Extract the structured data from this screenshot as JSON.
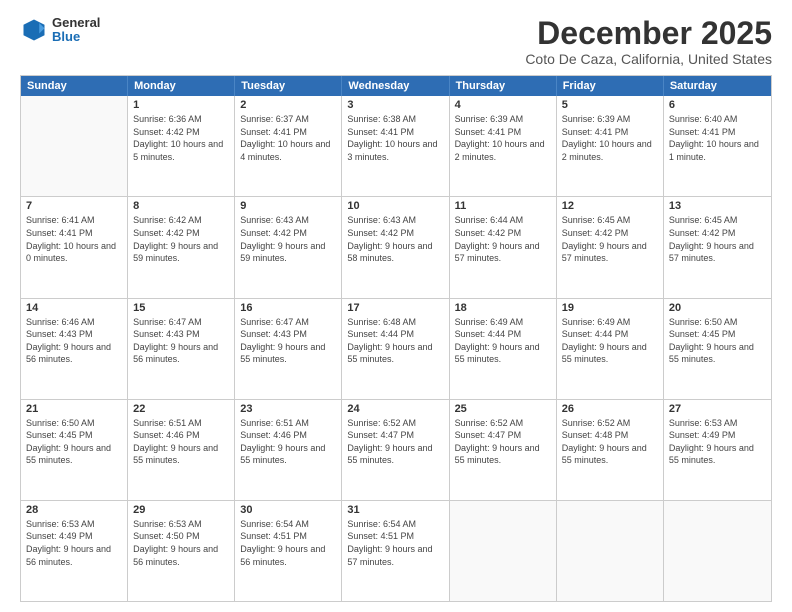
{
  "header": {
    "logo_general": "General",
    "logo_blue": "Blue",
    "main_title": "December 2025",
    "subtitle": "Coto De Caza, California, United States"
  },
  "days_of_week": [
    "Sunday",
    "Monday",
    "Tuesday",
    "Wednesday",
    "Thursday",
    "Friday",
    "Saturday"
  ],
  "weeks": [
    [
      {
        "day": "",
        "sunrise": "",
        "sunset": "",
        "daylight": "",
        "empty": true
      },
      {
        "day": "1",
        "sunrise": "Sunrise: 6:36 AM",
        "sunset": "Sunset: 4:42 PM",
        "daylight": "Daylight: 10 hours and 5 minutes."
      },
      {
        "day": "2",
        "sunrise": "Sunrise: 6:37 AM",
        "sunset": "Sunset: 4:41 PM",
        "daylight": "Daylight: 10 hours and 4 minutes."
      },
      {
        "day": "3",
        "sunrise": "Sunrise: 6:38 AM",
        "sunset": "Sunset: 4:41 PM",
        "daylight": "Daylight: 10 hours and 3 minutes."
      },
      {
        "day": "4",
        "sunrise": "Sunrise: 6:39 AM",
        "sunset": "Sunset: 4:41 PM",
        "daylight": "Daylight: 10 hours and 2 minutes."
      },
      {
        "day": "5",
        "sunrise": "Sunrise: 6:39 AM",
        "sunset": "Sunset: 4:41 PM",
        "daylight": "Daylight: 10 hours and 2 minutes."
      },
      {
        "day": "6",
        "sunrise": "Sunrise: 6:40 AM",
        "sunset": "Sunset: 4:41 PM",
        "daylight": "Daylight: 10 hours and 1 minute."
      }
    ],
    [
      {
        "day": "7",
        "sunrise": "Sunrise: 6:41 AM",
        "sunset": "Sunset: 4:41 PM",
        "daylight": "Daylight: 10 hours and 0 minutes."
      },
      {
        "day": "8",
        "sunrise": "Sunrise: 6:42 AM",
        "sunset": "Sunset: 4:42 PM",
        "daylight": "Daylight: 9 hours and 59 minutes."
      },
      {
        "day": "9",
        "sunrise": "Sunrise: 6:43 AM",
        "sunset": "Sunset: 4:42 PM",
        "daylight": "Daylight: 9 hours and 59 minutes."
      },
      {
        "day": "10",
        "sunrise": "Sunrise: 6:43 AM",
        "sunset": "Sunset: 4:42 PM",
        "daylight": "Daylight: 9 hours and 58 minutes."
      },
      {
        "day": "11",
        "sunrise": "Sunrise: 6:44 AM",
        "sunset": "Sunset: 4:42 PM",
        "daylight": "Daylight: 9 hours and 57 minutes."
      },
      {
        "day": "12",
        "sunrise": "Sunrise: 6:45 AM",
        "sunset": "Sunset: 4:42 PM",
        "daylight": "Daylight: 9 hours and 57 minutes."
      },
      {
        "day": "13",
        "sunrise": "Sunrise: 6:45 AM",
        "sunset": "Sunset: 4:42 PM",
        "daylight": "Daylight: 9 hours and 57 minutes."
      }
    ],
    [
      {
        "day": "14",
        "sunrise": "Sunrise: 6:46 AM",
        "sunset": "Sunset: 4:43 PM",
        "daylight": "Daylight: 9 hours and 56 minutes."
      },
      {
        "day": "15",
        "sunrise": "Sunrise: 6:47 AM",
        "sunset": "Sunset: 4:43 PM",
        "daylight": "Daylight: 9 hours and 56 minutes."
      },
      {
        "day": "16",
        "sunrise": "Sunrise: 6:47 AM",
        "sunset": "Sunset: 4:43 PM",
        "daylight": "Daylight: 9 hours and 55 minutes."
      },
      {
        "day": "17",
        "sunrise": "Sunrise: 6:48 AM",
        "sunset": "Sunset: 4:44 PM",
        "daylight": "Daylight: 9 hours and 55 minutes."
      },
      {
        "day": "18",
        "sunrise": "Sunrise: 6:49 AM",
        "sunset": "Sunset: 4:44 PM",
        "daylight": "Daylight: 9 hours and 55 minutes."
      },
      {
        "day": "19",
        "sunrise": "Sunrise: 6:49 AM",
        "sunset": "Sunset: 4:44 PM",
        "daylight": "Daylight: 9 hours and 55 minutes."
      },
      {
        "day": "20",
        "sunrise": "Sunrise: 6:50 AM",
        "sunset": "Sunset: 4:45 PM",
        "daylight": "Daylight: 9 hours and 55 minutes."
      }
    ],
    [
      {
        "day": "21",
        "sunrise": "Sunrise: 6:50 AM",
        "sunset": "Sunset: 4:45 PM",
        "daylight": "Daylight: 9 hours and 55 minutes."
      },
      {
        "day": "22",
        "sunrise": "Sunrise: 6:51 AM",
        "sunset": "Sunset: 4:46 PM",
        "daylight": "Daylight: 9 hours and 55 minutes."
      },
      {
        "day": "23",
        "sunrise": "Sunrise: 6:51 AM",
        "sunset": "Sunset: 4:46 PM",
        "daylight": "Daylight: 9 hours and 55 minutes."
      },
      {
        "day": "24",
        "sunrise": "Sunrise: 6:52 AM",
        "sunset": "Sunset: 4:47 PM",
        "daylight": "Daylight: 9 hours and 55 minutes."
      },
      {
        "day": "25",
        "sunrise": "Sunrise: 6:52 AM",
        "sunset": "Sunset: 4:47 PM",
        "daylight": "Daylight: 9 hours and 55 minutes."
      },
      {
        "day": "26",
        "sunrise": "Sunrise: 6:52 AM",
        "sunset": "Sunset: 4:48 PM",
        "daylight": "Daylight: 9 hours and 55 minutes."
      },
      {
        "day": "27",
        "sunrise": "Sunrise: 6:53 AM",
        "sunset": "Sunset: 4:49 PM",
        "daylight": "Daylight: 9 hours and 55 minutes."
      }
    ],
    [
      {
        "day": "28",
        "sunrise": "Sunrise: 6:53 AM",
        "sunset": "Sunset: 4:49 PM",
        "daylight": "Daylight: 9 hours and 56 minutes."
      },
      {
        "day": "29",
        "sunrise": "Sunrise: 6:53 AM",
        "sunset": "Sunset: 4:50 PM",
        "daylight": "Daylight: 9 hours and 56 minutes."
      },
      {
        "day": "30",
        "sunrise": "Sunrise: 6:54 AM",
        "sunset": "Sunset: 4:51 PM",
        "daylight": "Daylight: 9 hours and 56 minutes."
      },
      {
        "day": "31",
        "sunrise": "Sunrise: 6:54 AM",
        "sunset": "Sunset: 4:51 PM",
        "daylight": "Daylight: 9 hours and 57 minutes."
      },
      {
        "day": "",
        "sunrise": "",
        "sunset": "",
        "daylight": "",
        "empty": true
      },
      {
        "day": "",
        "sunrise": "",
        "sunset": "",
        "daylight": "",
        "empty": true
      },
      {
        "day": "",
        "sunrise": "",
        "sunset": "",
        "daylight": "",
        "empty": true
      }
    ]
  ]
}
